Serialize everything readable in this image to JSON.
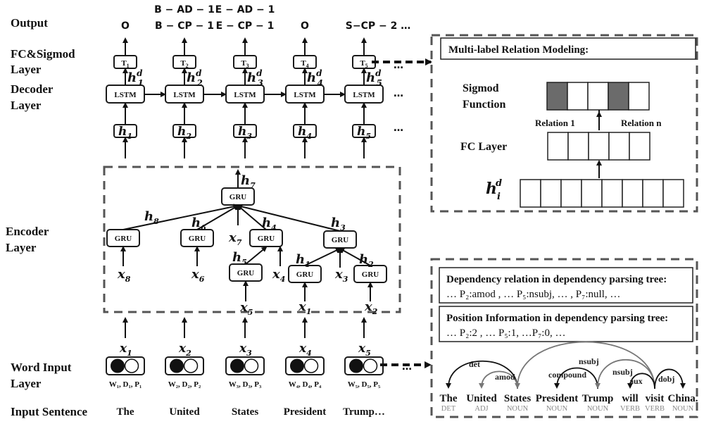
{
  "layers": {
    "output": "Output",
    "fc_sigmod": [
      "FC&Sigmod",
      "Layer"
    ],
    "decoder": [
      "Decoder",
      "Layer"
    ],
    "encoder": [
      "Encoder",
      "Layer"
    ],
    "word_input": [
      "Word Input",
      "Layer"
    ],
    "input_sentence": "Input Sentence"
  },
  "outputs": [
    {
      "lines": [
        "O"
      ]
    },
    {
      "lines": [
        "B − AD − 1",
        "B − CP − 1"
      ]
    },
    {
      "lines": [
        "E − AD − 1",
        "E − CP − 1"
      ]
    },
    {
      "lines": [
        "O"
      ]
    },
    {
      "lines": [
        "S−CP − 2 …"
      ]
    }
  ],
  "decoder": {
    "cell_label": "LSTM",
    "tag_base": "T",
    "hidden_base": "h",
    "hidden_sup": "d",
    "steps": [
      "1",
      "2",
      "3",
      "4",
      "5"
    ],
    "ellipsis": "…"
  },
  "encoder": {
    "cell_label": "GRU",
    "hidden_labels": [
      "h",
      "h",
      "h",
      "h",
      "h",
      "h",
      "h",
      "h"
    ],
    "nodes": {
      "root": {
        "out": "7"
      },
      "n8": {
        "edge": "8",
        "input": "8"
      },
      "n6": {
        "edge": "6",
        "input": "6"
      },
      "x7": "7",
      "n4": {
        "edge": "4",
        "input": "4"
      },
      "n5": {
        "edge": "5",
        "input": "5"
      },
      "n3": {
        "edge": "3",
        "input": "3"
      },
      "n1": {
        "edge": "1",
        "input": "1"
      },
      "n2": {
        "edge": "2",
        "input": "2"
      }
    }
  },
  "word_inputs": [
    {
      "x": "1",
      "feat": "W₁, D₁, P₁",
      "word": "The"
    },
    {
      "x": "2",
      "feat": "W₂, D₂, P₂",
      "word": "United"
    },
    {
      "x": "3",
      "feat": "W₃, D₃, P₃",
      "word": "States"
    },
    {
      "x": "4",
      "feat": "W₄, D₄, P₄",
      "word": "President"
    },
    {
      "x": "5",
      "feat": "W₅, D₅, P₅",
      "word": "Trump…"
    }
  ],
  "relation_panel": {
    "title": "Multi-label Relation Modeling:",
    "sigmod_label": [
      "Sigmod",
      "Function"
    ],
    "fc_label": "FC Layer",
    "relation_first": "Relation 1",
    "relation_last": "Relation n",
    "hidden_base": "h",
    "hidden_sub": "i",
    "hidden_sup": "d",
    "sigmoid_active": [
      true,
      false,
      false,
      true,
      false
    ],
    "fc_cells": 5,
    "hidden_cells": 8
  },
  "dependency_panel": {
    "relation_title": "Dependency relation in dependency parsing tree:",
    "relation_items": "…  P₂:amod , … P₅:nsubj, … , P₇:null, …",
    "position_title": "Position Information in  dependency parsing tree:",
    "position_items": "… P₂:2 , … P₅:1, …P₇:0, …",
    "tokens": [
      {
        "word": "The",
        "pos": "DET"
      },
      {
        "word": "United",
        "pos": "ADJ"
      },
      {
        "word": "States",
        "pos": "NOUN"
      },
      {
        "word": "President",
        "pos": "NOUN"
      },
      {
        "word": "Trump",
        "pos": "NOUN"
      },
      {
        "word": "will",
        "pos": "VERB"
      },
      {
        "word": "visit",
        "pos": "VERB"
      },
      {
        "word": "China.",
        "pos": "NOUN"
      }
    ],
    "arcs": [
      {
        "label": "det",
        "from": 2,
        "to": 0
      },
      {
        "label": "amod",
        "from": 2,
        "to": 1
      },
      {
        "label": "nsubj",
        "from": 6,
        "to": 2
      },
      {
        "label": "compound",
        "from": 4,
        "to": 3
      },
      {
        "label": "nsubj",
        "from": 6,
        "to": 4
      },
      {
        "label": "aux",
        "from": 6,
        "to": 5
      },
      {
        "label": "dobj",
        "from": 6,
        "to": 7
      }
    ]
  }
}
